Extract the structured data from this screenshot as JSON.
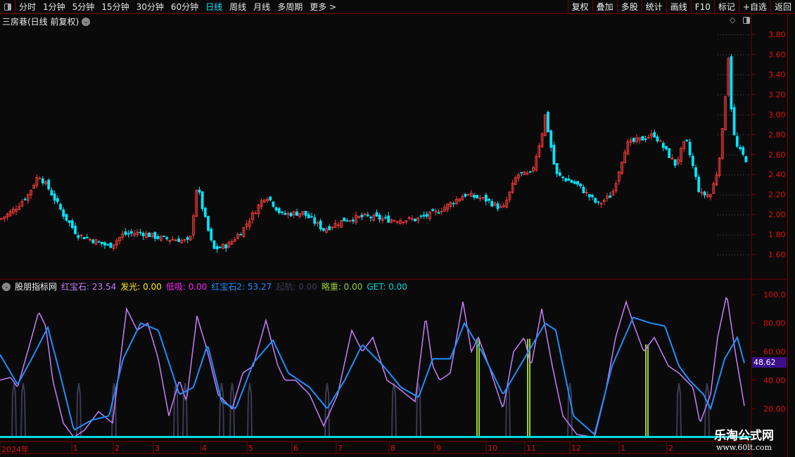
{
  "toolbar": {
    "periods": [
      "分时",
      "1分钟",
      "5分钟",
      "15分钟",
      "30分钟",
      "60分钟",
      "日线",
      "周线",
      "月线",
      "多周期",
      "更多 >"
    ],
    "active": "日线",
    "right": [
      "复权",
      "叠加",
      "多股",
      "统计",
      "画线",
      "F10",
      "标记",
      "+自选",
      "返回"
    ]
  },
  "chart_title": "三房巷(日线 前复权)",
  "indicator": {
    "name": "股朋指标网",
    "items": [
      {
        "label": "红宝石: 23.54",
        "color": "#c77dff"
      },
      {
        "label": "发光: 0.00",
        "color": "#ffee00"
      },
      {
        "label": "低吸: 0.00",
        "color": "#ff22ff"
      },
      {
        "label": "红宝石2: 53.27",
        "color": "#1e8fff"
      },
      {
        "label": "起航: 0.00",
        "color": "#3a3a55"
      },
      {
        "label": "略重: 0.00",
        "color": "#9acd32"
      },
      {
        "label": "GET: 0.00",
        "color": "#00d8e0"
      }
    ],
    "current_value": "48.62"
  },
  "price_axis": [
    "3.80",
    "3.60",
    "3.40",
    "3.20",
    "3.00",
    "2.80",
    "2.60",
    "2.40",
    "2.20",
    "2.00",
    "1.80",
    "1.60"
  ],
  "ind_axis": [
    "100.0",
    "80.00",
    "60.00",
    "40.00",
    "20.00"
  ],
  "x_axis": [
    "2024年",
    "1",
    "2",
    "3",
    "4",
    "5",
    "6",
    "7",
    "8",
    "9",
    "10",
    "11",
    "12",
    "1",
    "2"
  ],
  "watermark": {
    "name": "乐淘公式网",
    "url": "www.60lt.com"
  },
  "colors": {
    "up": "#ff3b3b",
    "down": "#00e5ff",
    "axis": "#e01010",
    "grid": "#7a0000"
  },
  "price_path": [
    [
      0,
      1.95
    ],
    [
      20,
      2.05
    ],
    [
      40,
      2.2
    ],
    [
      55,
      2.4
    ],
    [
      70,
      2.25
    ],
    [
      90,
      2.0
    ],
    [
      110,
      1.8
    ],
    [
      130,
      1.75
    ],
    [
      155,
      1.68
    ],
    [
      175,
      1.8
    ],
    [
      200,
      1.82
    ],
    [
      230,
      1.76
    ],
    [
      255,
      1.75
    ],
    [
      270,
      1.72
    ],
    [
      280,
      2.3
    ],
    [
      290,
      2.0
    ],
    [
      303,
      1.65
    ],
    [
      325,
      1.7
    ],
    [
      345,
      1.85
    ],
    [
      378,
      2.2
    ],
    [
      400,
      2.0
    ],
    [
      430,
      2.02
    ],
    [
      460,
      1.85
    ],
    [
      490,
      1.95
    ],
    [
      520,
      1.98
    ],
    [
      550,
      1.95
    ],
    [
      590,
      1.95
    ],
    [
      620,
      2.02
    ],
    [
      660,
      2.2
    ],
    [
      690,
      2.15
    ],
    [
      715,
      2.05
    ],
    [
      735,
      2.4
    ],
    [
      755,
      2.4
    ],
    [
      770,
      2.8
    ],
    [
      775,
      3.0
    ],
    [
      790,
      2.4
    ],
    [
      820,
      2.3
    ],
    [
      850,
      2.1
    ],
    [
      870,
      2.2
    ],
    [
      890,
      2.7
    ],
    [
      930,
      2.8
    ],
    [
      960,
      2.5
    ],
    [
      975,
      2.75
    ],
    [
      995,
      2.2
    ],
    [
      1010,
      2.2
    ],
    [
      1020,
      2.45
    ],
    [
      1028,
      2.9
    ],
    [
      1035,
      3.6
    ],
    [
      1040,
      3.0
    ],
    [
      1045,
      2.7
    ],
    [
      1060,
      2.55
    ]
  ],
  "ruby": [
    [
      0,
      40
    ],
    [
      15,
      42
    ],
    [
      25,
      35
    ],
    [
      45,
      70
    ],
    [
      55,
      88
    ],
    [
      65,
      78
    ],
    [
      75,
      40
    ],
    [
      90,
      10
    ],
    [
      105,
      0
    ],
    [
      120,
      5
    ],
    [
      140,
      18
    ],
    [
      160,
      10
    ],
    [
      180,
      90
    ],
    [
      195,
      75
    ],
    [
      210,
      80
    ],
    [
      225,
      55
    ],
    [
      240,
      15
    ],
    [
      255,
      40
    ],
    [
      265,
      25
    ],
    [
      280,
      85
    ],
    [
      295,
      60
    ],
    [
      310,
      30
    ],
    [
      330,
      20
    ],
    [
      345,
      45
    ],
    [
      360,
      50
    ],
    [
      378,
      82
    ],
    [
      395,
      50
    ],
    [
      405,
      40
    ],
    [
      420,
      40
    ],
    [
      440,
      30
    ],
    [
      460,
      8
    ],
    [
      480,
      30
    ],
    [
      500,
      75
    ],
    [
      515,
      60
    ],
    [
      530,
      70
    ],
    [
      550,
      40
    ],
    [
      565,
      35
    ],
    [
      590,
      25
    ],
    [
      605,
      85
    ],
    [
      615,
      50
    ],
    [
      625,
      40
    ],
    [
      640,
      45
    ],
    [
      658,
      95
    ],
    [
      670,
      60
    ],
    [
      680,
      70
    ],
    [
      695,
      50
    ],
    [
      715,
      20
    ],
    [
      730,
      60
    ],
    [
      745,
      70
    ],
    [
      755,
      50
    ],
    [
      770,
      90
    ],
    [
      785,
      50
    ],
    [
      800,
      15
    ],
    [
      820,
      2
    ],
    [
      845,
      0
    ],
    [
      860,
      30
    ],
    [
      875,
      70
    ],
    [
      890,
      95
    ],
    [
      900,
      80
    ],
    [
      915,
      60
    ],
    [
      930,
      70
    ],
    [
      950,
      50
    ],
    [
      965,
      45
    ],
    [
      975,
      40
    ],
    [
      985,
      35
    ],
    [
      995,
      10
    ],
    [
      1010,
      30
    ],
    [
      1020,
      70
    ],
    [
      1033,
      100
    ],
    [
      1045,
      60
    ],
    [
      1058,
      22
    ]
  ],
  "ruby2": [
    [
      0,
      58
    ],
    [
      25,
      37
    ],
    [
      45,
      55
    ],
    [
      68,
      77
    ],
    [
      85,
      45
    ],
    [
      105,
      5
    ],
    [
      130,
      12
    ],
    [
      155,
      15
    ],
    [
      175,
      55
    ],
    [
      200,
      80
    ],
    [
      225,
      75
    ],
    [
      255,
      30
    ],
    [
      275,
      35
    ],
    [
      295,
      65
    ],
    [
      315,
      25
    ],
    [
      335,
      20
    ],
    [
      360,
      52
    ],
    [
      388,
      68
    ],
    [
      410,
      45
    ],
    [
      440,
      35
    ],
    [
      465,
      20
    ],
    [
      490,
      40
    ],
    [
      515,
      65
    ],
    [
      545,
      50
    ],
    [
      570,
      35
    ],
    [
      595,
      28
    ],
    [
      615,
      55
    ],
    [
      640,
      55
    ],
    [
      660,
      80
    ],
    [
      685,
      60
    ],
    [
      715,
      30
    ],
    [
      745,
      55
    ],
    [
      775,
      80
    ],
    [
      790,
      75
    ],
    [
      815,
      15
    ],
    [
      845,
      2
    ],
    [
      870,
      50
    ],
    [
      900,
      84
    ],
    [
      925,
      80
    ],
    [
      945,
      78
    ],
    [
      965,
      50
    ],
    [
      980,
      40
    ],
    [
      1000,
      30
    ],
    [
      1010,
      20
    ],
    [
      1030,
      55
    ],
    [
      1048,
      70
    ],
    [
      1058,
      52
    ]
  ],
  "qihang_spikes": [
    20,
    33,
    112,
    162,
    250,
    263,
    315,
    330,
    355,
    465,
    560,
    595,
    722,
    810,
    965,
    1005
  ],
  "lvezhong_spikes": [
    680,
    752,
    920
  ]
}
